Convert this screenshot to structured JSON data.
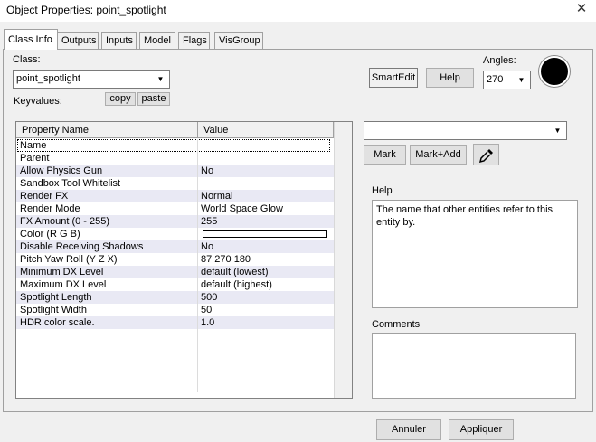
{
  "window": {
    "title": "Object Properties: point_spotlight",
    "close_glyph": "✕"
  },
  "tabs": [
    {
      "label": "Class Info",
      "active": true
    },
    {
      "label": "Outputs"
    },
    {
      "label": "Inputs"
    },
    {
      "label": "Model"
    },
    {
      "label": "Flags"
    },
    {
      "label": "VisGroup"
    }
  ],
  "class_section": {
    "class_label": "Class:",
    "class_value": "point_spotlight",
    "keyvalues_label": "Keyvalues:",
    "copy_label": "copy",
    "paste_label": "paste"
  },
  "toolbar": {
    "smartedit_label": "SmartEdit",
    "help_label": "Help",
    "angles_label": "Angles:",
    "angles_value": "270"
  },
  "grid": {
    "headers": {
      "name": "Property Name",
      "value": "Value"
    },
    "rows": [
      {
        "name": "Name",
        "value": ""
      },
      {
        "name": "Parent",
        "value": ""
      },
      {
        "name": "Allow Physics Gun",
        "value": "No"
      },
      {
        "name": "Sandbox Tool Whitelist",
        "value": ""
      },
      {
        "name": "Render FX",
        "value": "Normal"
      },
      {
        "name": "Render Mode",
        "value": "World Space Glow"
      },
      {
        "name": "FX Amount (0 - 255)",
        "value": "255"
      },
      {
        "name": "Color (R G B)",
        "value": ""
      },
      {
        "name": "Disable Receiving Shadows",
        "value": "No"
      },
      {
        "name": "Pitch Yaw Roll (Y Z X)",
        "value": "87 270 180"
      },
      {
        "name": "Minimum DX Level",
        "value": "default (lowest)"
      },
      {
        "name": "Maximum DX Level",
        "value": "default (highest)"
      },
      {
        "name": "Spotlight Length",
        "value": "500"
      },
      {
        "name": "Spotlight Width",
        "value": "50"
      },
      {
        "name": "HDR color scale.",
        "value": "1.0"
      }
    ]
  },
  "right_panel": {
    "mark_label": "Mark",
    "mark_add_label": "Mark+Add",
    "eyedropper_icon": "eyedropper-icon",
    "help_title": "Help",
    "help_text": "The name that other entities refer to this entity by.",
    "comments_title": "Comments",
    "comments_value": ""
  },
  "footer": {
    "cancel_label": "Annuler",
    "apply_label": "Appliquer"
  },
  "colors": {
    "alt_row": "#e9e9f4",
    "window_bg": "#f0f0f0",
    "ball": "#000000"
  }
}
